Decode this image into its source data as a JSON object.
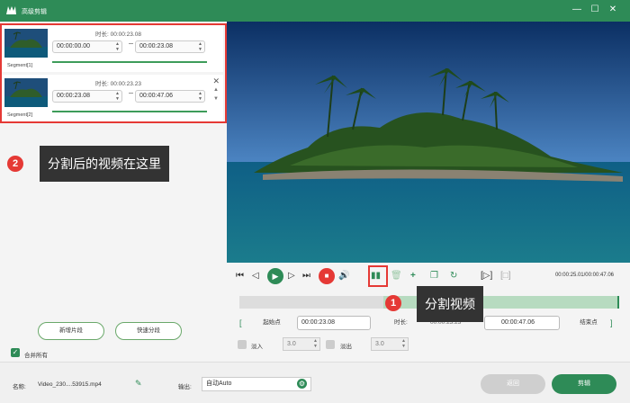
{
  "window": {
    "title": "高级剪辑"
  },
  "segments": [
    {
      "label": "Segment[1]",
      "duration": "时长: 00:00:23.08",
      "start": "00:00:00.00",
      "end": "00:00:23.08"
    },
    {
      "label": "Segment[2]",
      "duration": "时长: 00:00:23.23",
      "start": "00:00:23.08",
      "end": "00:00:47.06"
    }
  ],
  "callouts": {
    "one": {
      "number": "1",
      "text": "分割视频"
    },
    "two": {
      "number": "2",
      "text": "分割后的视频在这里"
    }
  },
  "left_buttons": {
    "new_clip": "新增片段",
    "quick_split": "快速分段",
    "merge_all": "合并所有"
  },
  "player": {
    "timecode": "00:00:25.01/00:00:47.06"
  },
  "trim": {
    "start_label": "起始点",
    "start_value": "00:00:23.08",
    "duration_label": "时长:",
    "duration_value": "00:00:23.23",
    "end_value": "00:00:47.06",
    "end_label": "结束点"
  },
  "fade": {
    "in_label": "淡入",
    "in_value": "3.0",
    "out_label": "淡出",
    "out_value": "3.0"
  },
  "bottom": {
    "name_label": "名称:",
    "file_name": "Video_230....53915.mp4",
    "output_label": "输出:",
    "output_value": "自动Auto",
    "back_label": "返回",
    "cut_label": "剪辑"
  },
  "colors": {
    "brand": "#2e8b57",
    "highlight": "#e53935"
  },
  "icons": [
    "logo-icon",
    "minimize-icon",
    "maximize-icon",
    "close-icon",
    "prev-frame-icon",
    "play-icon",
    "stop-icon",
    "volume-icon",
    "split-icon",
    "delete-icon",
    "add-icon",
    "copy-icon",
    "rotate-icon",
    "crop-icon",
    "edit-icon",
    "gear-icon"
  ]
}
